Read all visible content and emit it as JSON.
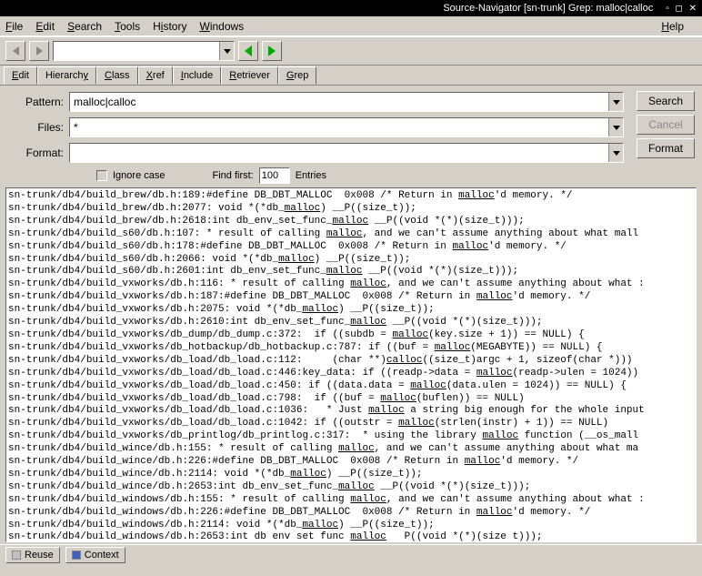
{
  "titlebar": {
    "title": "Source-Navigator [sn-trunk] Grep: malloc|calloc",
    "controls": "▫ ◻ ✕"
  },
  "menubar": {
    "file": "File",
    "edit": "Edit",
    "search": "Search",
    "tools": "Tools",
    "history": "History",
    "windows": "Windows",
    "help": "Help"
  },
  "toolbar": {
    "combo_value": ""
  },
  "tabs": {
    "edit": "Edit",
    "hierarchy": "Hierarchy",
    "class": "Class",
    "xref": "Xref",
    "include": "Include",
    "retriever": "Retriever",
    "grep": "Grep"
  },
  "form": {
    "pattern_label": "Pattern:",
    "pattern_value": "malloc|calloc",
    "files_label": "Files:",
    "files_value": "*",
    "format_label": "Format:",
    "format_value": "",
    "search_btn": "Search",
    "cancel_btn": "Cancel",
    "format_btn": "Format",
    "ignore_case": "Ignore case",
    "find_first": "Find first:",
    "find_first_count": "100",
    "entries": "Entries"
  },
  "statusbar": {
    "reuse": "Reuse",
    "context": "Context"
  },
  "results": [
    {
      "pre": "sn-trunk/db4/build_brew/db.h:189:#define DB_DBT_MALLOC  0x008 /* Return in ",
      "hl": "malloc",
      "post": "'d memory. */"
    },
    {
      "pre": "sn-trunk/db4/build_brew/db.h:2077: void *(*db_",
      "hl": "malloc",
      "post": ") __P((size_t));"
    },
    {
      "pre": "sn-trunk/db4/build_brew/db.h:2618:int db_env_set_func_",
      "hl": "malloc",
      "post": " __P((void *(*)(size_t)));"
    },
    {
      "pre": "sn-trunk/db4/build_s60/db.h:107: * result of calling ",
      "hl": "malloc",
      "post": ", and we can't assume anything about what mall"
    },
    {
      "pre": "sn-trunk/db4/build_s60/db.h:178:#define DB_DBT_MALLOC  0x008 /* Return in ",
      "hl": "malloc",
      "post": "'d memory. */"
    },
    {
      "pre": "sn-trunk/db4/build_s60/db.h:2066: void *(*db_",
      "hl": "malloc",
      "post": ") __P((size_t));"
    },
    {
      "pre": "sn-trunk/db4/build_s60/db.h:2601:int db_env_set_func_",
      "hl": "malloc",
      "post": " __P((void *(*)(size_t)));"
    },
    {
      "pre": "sn-trunk/db4/build_vxworks/db.h:116: * result of calling ",
      "hl": "malloc",
      "post": ", and we can't assume anything about what :"
    },
    {
      "pre": "sn-trunk/db4/build_vxworks/db.h:187:#define DB_DBT_MALLOC  0x008 /* Return in ",
      "hl": "malloc",
      "post": "'d memory. */"
    },
    {
      "pre": "sn-trunk/db4/build_vxworks/db.h:2075: void *(*db_",
      "hl": "malloc",
      "post": ") __P((size_t));"
    },
    {
      "pre": "sn-trunk/db4/build_vxworks/db.h:2610:int db_env_set_func_",
      "hl": "malloc",
      "post": " __P((void *(*)(size_t)));"
    },
    {
      "pre": "sn-trunk/db4/build_vxworks/db_dump/db_dump.c:372:  if ((subdb = ",
      "hl": "malloc",
      "post": "(key.size + 1)) == NULL) {"
    },
    {
      "pre": "sn-trunk/db4/build_vxworks/db_hotbackup/db_hotbackup.c:787: if ((buf = ",
      "hl": "malloc",
      "post": "(MEGABYTE)) == NULL) {"
    },
    {
      "pre": "sn-trunk/db4/build_vxworks/db_load/db_load.c:112:     (char **)",
      "hl": "calloc",
      "post": "((size_t)argc + 1, sizeof(char *)))"
    },
    {
      "pre": "sn-trunk/db4/build_vxworks/db_load/db_load.c:446:key_data: if ((readp->data = ",
      "hl": "malloc",
      "post": "(readp->ulen = 1024))"
    },
    {
      "pre": "sn-trunk/db4/build_vxworks/db_load/db_load.c:450: if ((data.data = ",
      "hl": "malloc",
      "post": "(data.ulen = 1024)) == NULL) {"
    },
    {
      "pre": "sn-trunk/db4/build_vxworks/db_load/db_load.c:798:  if ((buf = ",
      "hl": "malloc",
      "post": "(buflen)) == NULL)"
    },
    {
      "pre": "sn-trunk/db4/build_vxworks/db_load/db_load.c:1036:   * Just ",
      "hl": "malloc",
      "post": " a string big enough for the whole input"
    },
    {
      "pre": "sn-trunk/db4/build_vxworks/db_load/db_load.c:1042: if ((outstr = ",
      "hl": "malloc",
      "post": "(strlen(instr) + 1)) == NULL)"
    },
    {
      "pre": "sn-trunk/db4/build_vxworks/db_printlog/db_printlog.c:317:  * using the library ",
      "hl": "malloc",
      "post": " function (__os_mall"
    },
    {
      "pre": "sn-trunk/db4/build_wince/db.h:155: * result of calling ",
      "hl": "malloc",
      "post": ", and we can't assume anything about what ma"
    },
    {
      "pre": "sn-trunk/db4/build_wince/db.h:226:#define DB_DBT_MALLOC  0x008 /* Return in ",
      "hl": "malloc",
      "post": "'d memory. */"
    },
    {
      "pre": "sn-trunk/db4/build_wince/db.h:2114: void *(*db_",
      "hl": "malloc",
      "post": ") __P((size_t));"
    },
    {
      "pre": "sn-trunk/db4/build_wince/db.h:2653:int db_env_set_func_",
      "hl": "malloc",
      "post": " __P((void *(*)(size_t)));"
    },
    {
      "pre": "sn-trunk/db4/build_windows/db.h:155: * result of calling ",
      "hl": "malloc",
      "post": ", and we can't assume anything about what :"
    },
    {
      "pre": "sn-trunk/db4/build_windows/db.h:226:#define DB_DBT_MALLOC  0x008 /* Return in ",
      "hl": "malloc",
      "post": "'d memory. */"
    },
    {
      "pre": "sn-trunk/db4/build_windows/db.h:2114: void *(*db_",
      "hl": "malloc",
      "post": ") __P((size_t));"
    },
    {
      "pre": "sn-trunk/db4/build_windows/db.h:2653:int db env set func ",
      "hl": "malloc",
      "post": "   P((void *(*)(size t)));"
    }
  ]
}
